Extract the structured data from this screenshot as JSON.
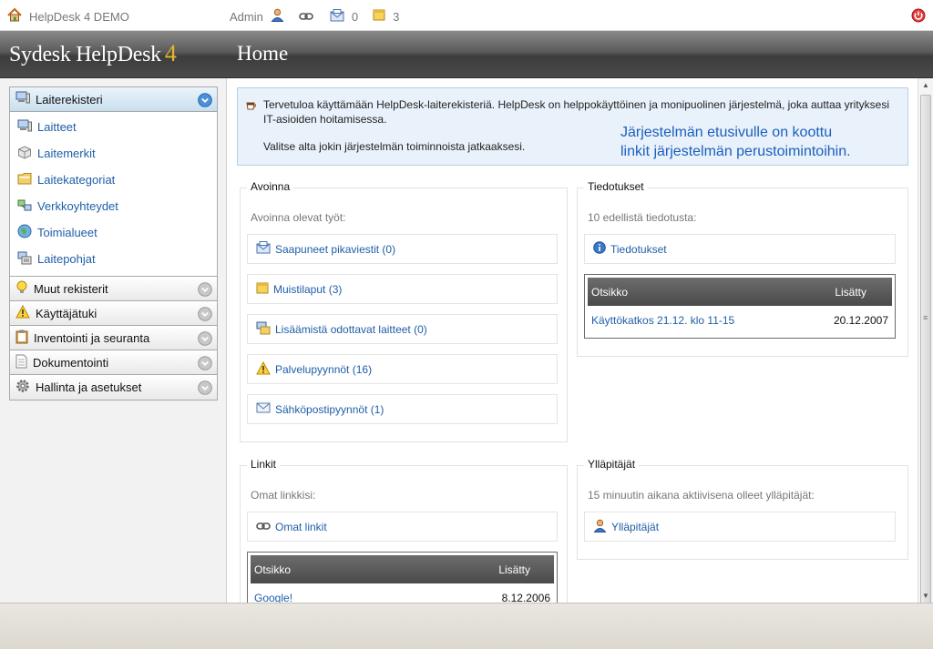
{
  "topbar": {
    "app_title": "HelpDesk 4 DEMO",
    "user_name": "Admin",
    "messages_count": "0",
    "notes_count": "3"
  },
  "header": {
    "logo_text": "Sydesk HelpDesk",
    "logo_version": "4",
    "page_title": "Home"
  },
  "sidebar": {
    "active_section": "Laiterekisteri",
    "links": [
      {
        "label": "Laitteet",
        "icon": "computer-icon"
      },
      {
        "label": "Laitemerkit",
        "icon": "brand-cube-icon"
      },
      {
        "label": "Laitekategoriat",
        "icon": "folder-icon"
      },
      {
        "label": "Verkkoyhteydet",
        "icon": "network-icon"
      },
      {
        "label": "Toimialueet",
        "icon": "globe-icon"
      },
      {
        "label": "Laitepohjat",
        "icon": "template-icon"
      }
    ],
    "sections": [
      {
        "label": "Muut rekisterit",
        "icon": "lightbulb-icon"
      },
      {
        "label": "Käyttäjätuki",
        "icon": "warning-icon"
      },
      {
        "label": "Inventointi ja seuranta",
        "icon": "clipboard-icon"
      },
      {
        "label": "Dokumentointi",
        "icon": "document-icon"
      },
      {
        "label": "Hallinta ja asetukset",
        "icon": "gear-icon"
      }
    ]
  },
  "welcome": {
    "line1": "Tervetuloa käyttämään HelpDesk-laiterekisteriä. HelpDesk on helppokäyttöinen ja monipuolinen järjestelmä, joka auttaa yrityksesi IT-asioiden hoitamisessa.",
    "line2": "Valitse alta jokin järjestelmän toiminnoista jatkaaksesi.",
    "callout_line1": "Järjestelmän etusivulle on koottu",
    "callout_line2": "linkit järjestelmän perustoimintoihin."
  },
  "avoinna": {
    "title": "Avoinna",
    "subtitle": "Avoinna olevat työt:",
    "items": [
      {
        "label": "Saapuneet pikaviestit (0)",
        "icon": "inbox-icon"
      },
      {
        "label": "Muistilaput (3)",
        "icon": "sticky-note-icon"
      },
      {
        "label": "Lisäämistä odottavat laitteet (0)",
        "icon": "pending-devices-icon"
      },
      {
        "label": "Palvelupyynnöt (16)",
        "icon": "warning-icon"
      },
      {
        "label": "Sähköpostipyynnöt (1)",
        "icon": "envelope-icon"
      }
    ]
  },
  "tiedotukset": {
    "title": "Tiedotukset",
    "subtitle": "10 edellistä tiedotusta:",
    "link_label": "Tiedotukset",
    "table": {
      "col_title": "Otsikko",
      "col_added": "Lisätty",
      "rows": [
        {
          "title": "Käyttökatkos 21.12. klo 11-15",
          "added": "20.12.2007"
        }
      ]
    }
  },
  "linkit": {
    "title": "Linkit",
    "subtitle": "Omat linkkisi:",
    "link_label": "Omat linkit",
    "table": {
      "col_title": "Otsikko",
      "col_added": "Lisätty",
      "rows": [
        {
          "title": "Google!",
          "added": "8.12.2006"
        }
      ]
    }
  },
  "yllapitajat": {
    "title": "Ylläpitäjät",
    "subtitle": "15 minuutin aikana aktiivisena olleet ylläpitäjät:",
    "link_label": "Ylläpitäjät"
  }
}
